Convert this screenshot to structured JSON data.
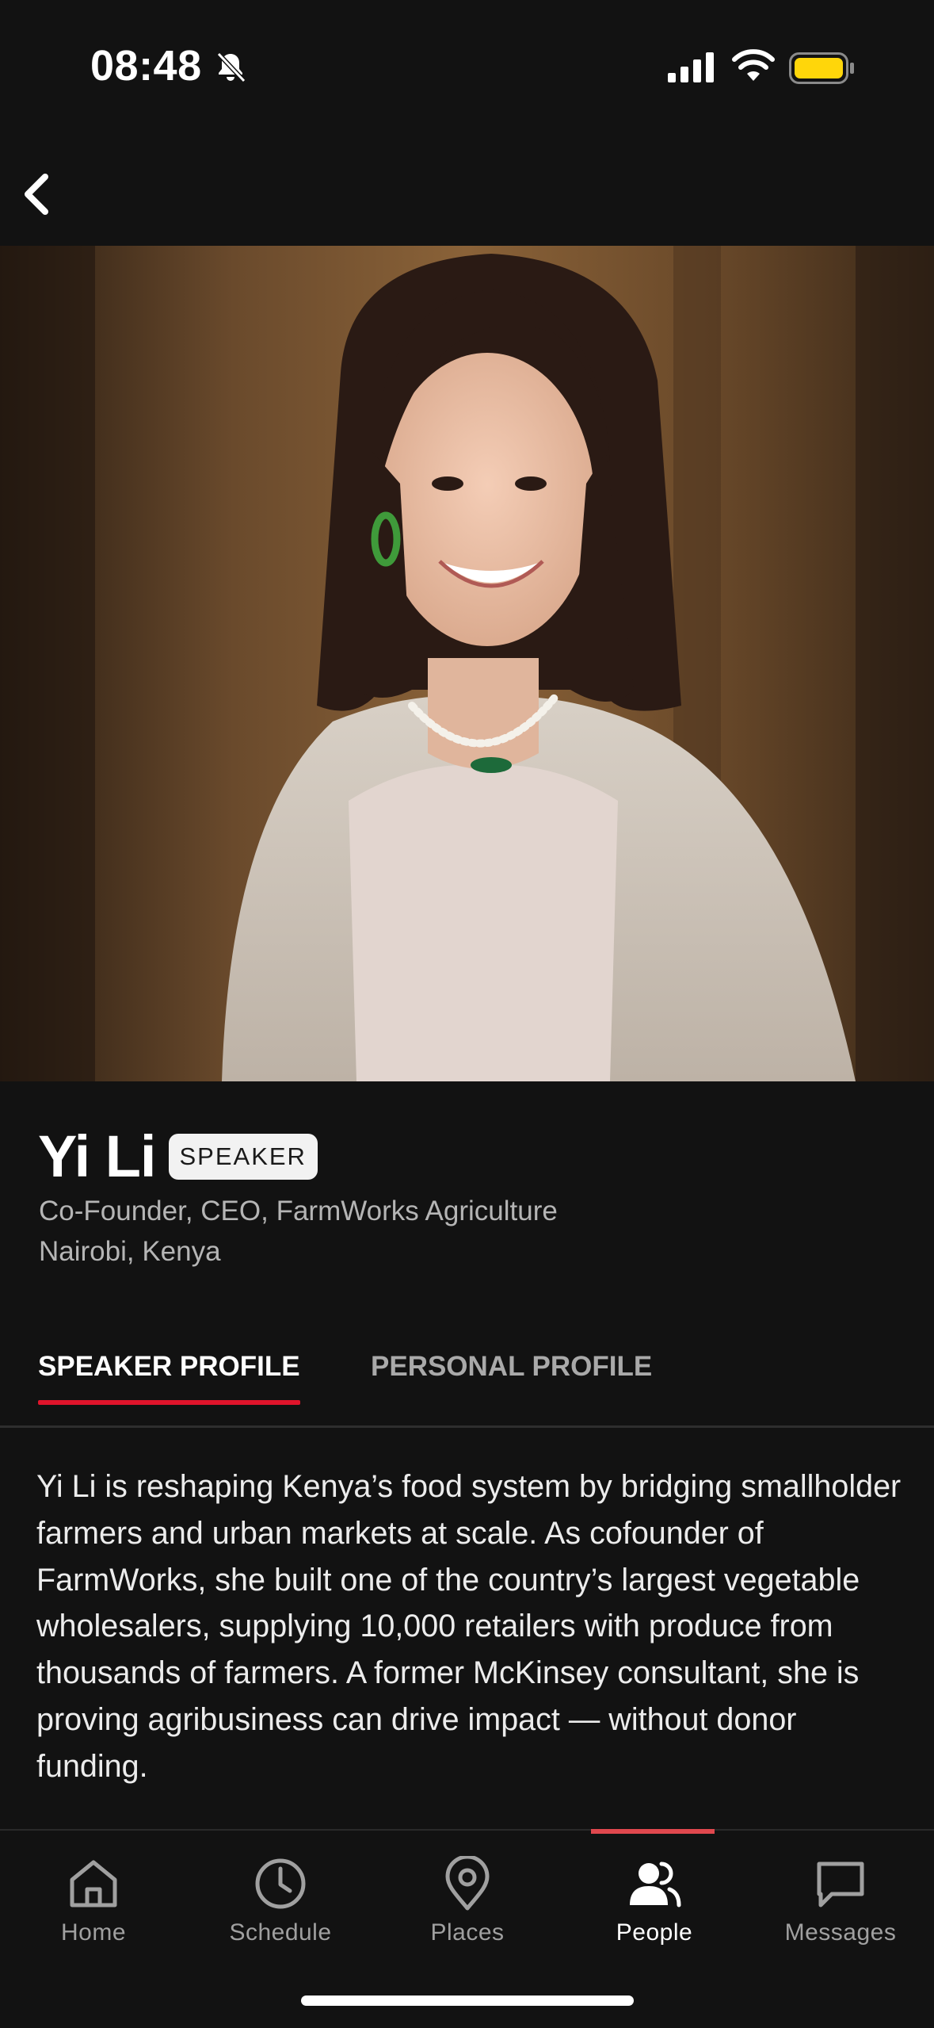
{
  "status_bar": {
    "time": "08:48",
    "bell_icon": "bell-slash-icon",
    "signal_icon": "cellular-signal-icon",
    "wifi_icon": "wifi-icon",
    "battery_icon": "battery-icon",
    "battery_color": "#FFD60A"
  },
  "header": {
    "back_icon": "chevron-left-icon"
  },
  "profile": {
    "name": "Yi Li",
    "badge": "SPEAKER",
    "title": "Co-Founder, CEO, FarmWorks Agriculture",
    "location": "Nairobi, Kenya"
  },
  "tabs": [
    {
      "label": "SPEAKER PROFILE",
      "active": true
    },
    {
      "label": "PERSONAL PROFILE",
      "active": false
    }
  ],
  "bio": "Yi Li is reshaping Kenya’s food system by bridging smallholder farmers and urban markets at scale. As cofounder of FarmWorks, she built one of the country’s largest vegetable wholesalers, supplying 10,000 retailers with produce from thousands of farmers. A former McKinsey consultant, she is proving agribusiness can drive impact — without donor funding.",
  "bottom_nav": [
    {
      "label": "Home",
      "icon": "home-icon",
      "active": false
    },
    {
      "label": "Schedule",
      "icon": "clock-icon",
      "active": false
    },
    {
      "label": "Places",
      "icon": "map-pin-icon",
      "active": false
    },
    {
      "label": "People",
      "icon": "people-icon",
      "active": true
    },
    {
      "label": "Messages",
      "icon": "message-icon",
      "active": false
    }
  ],
  "colors": {
    "background": "#121212",
    "accent": "#E0142B",
    "text_secondary": "#B5B5B5"
  }
}
